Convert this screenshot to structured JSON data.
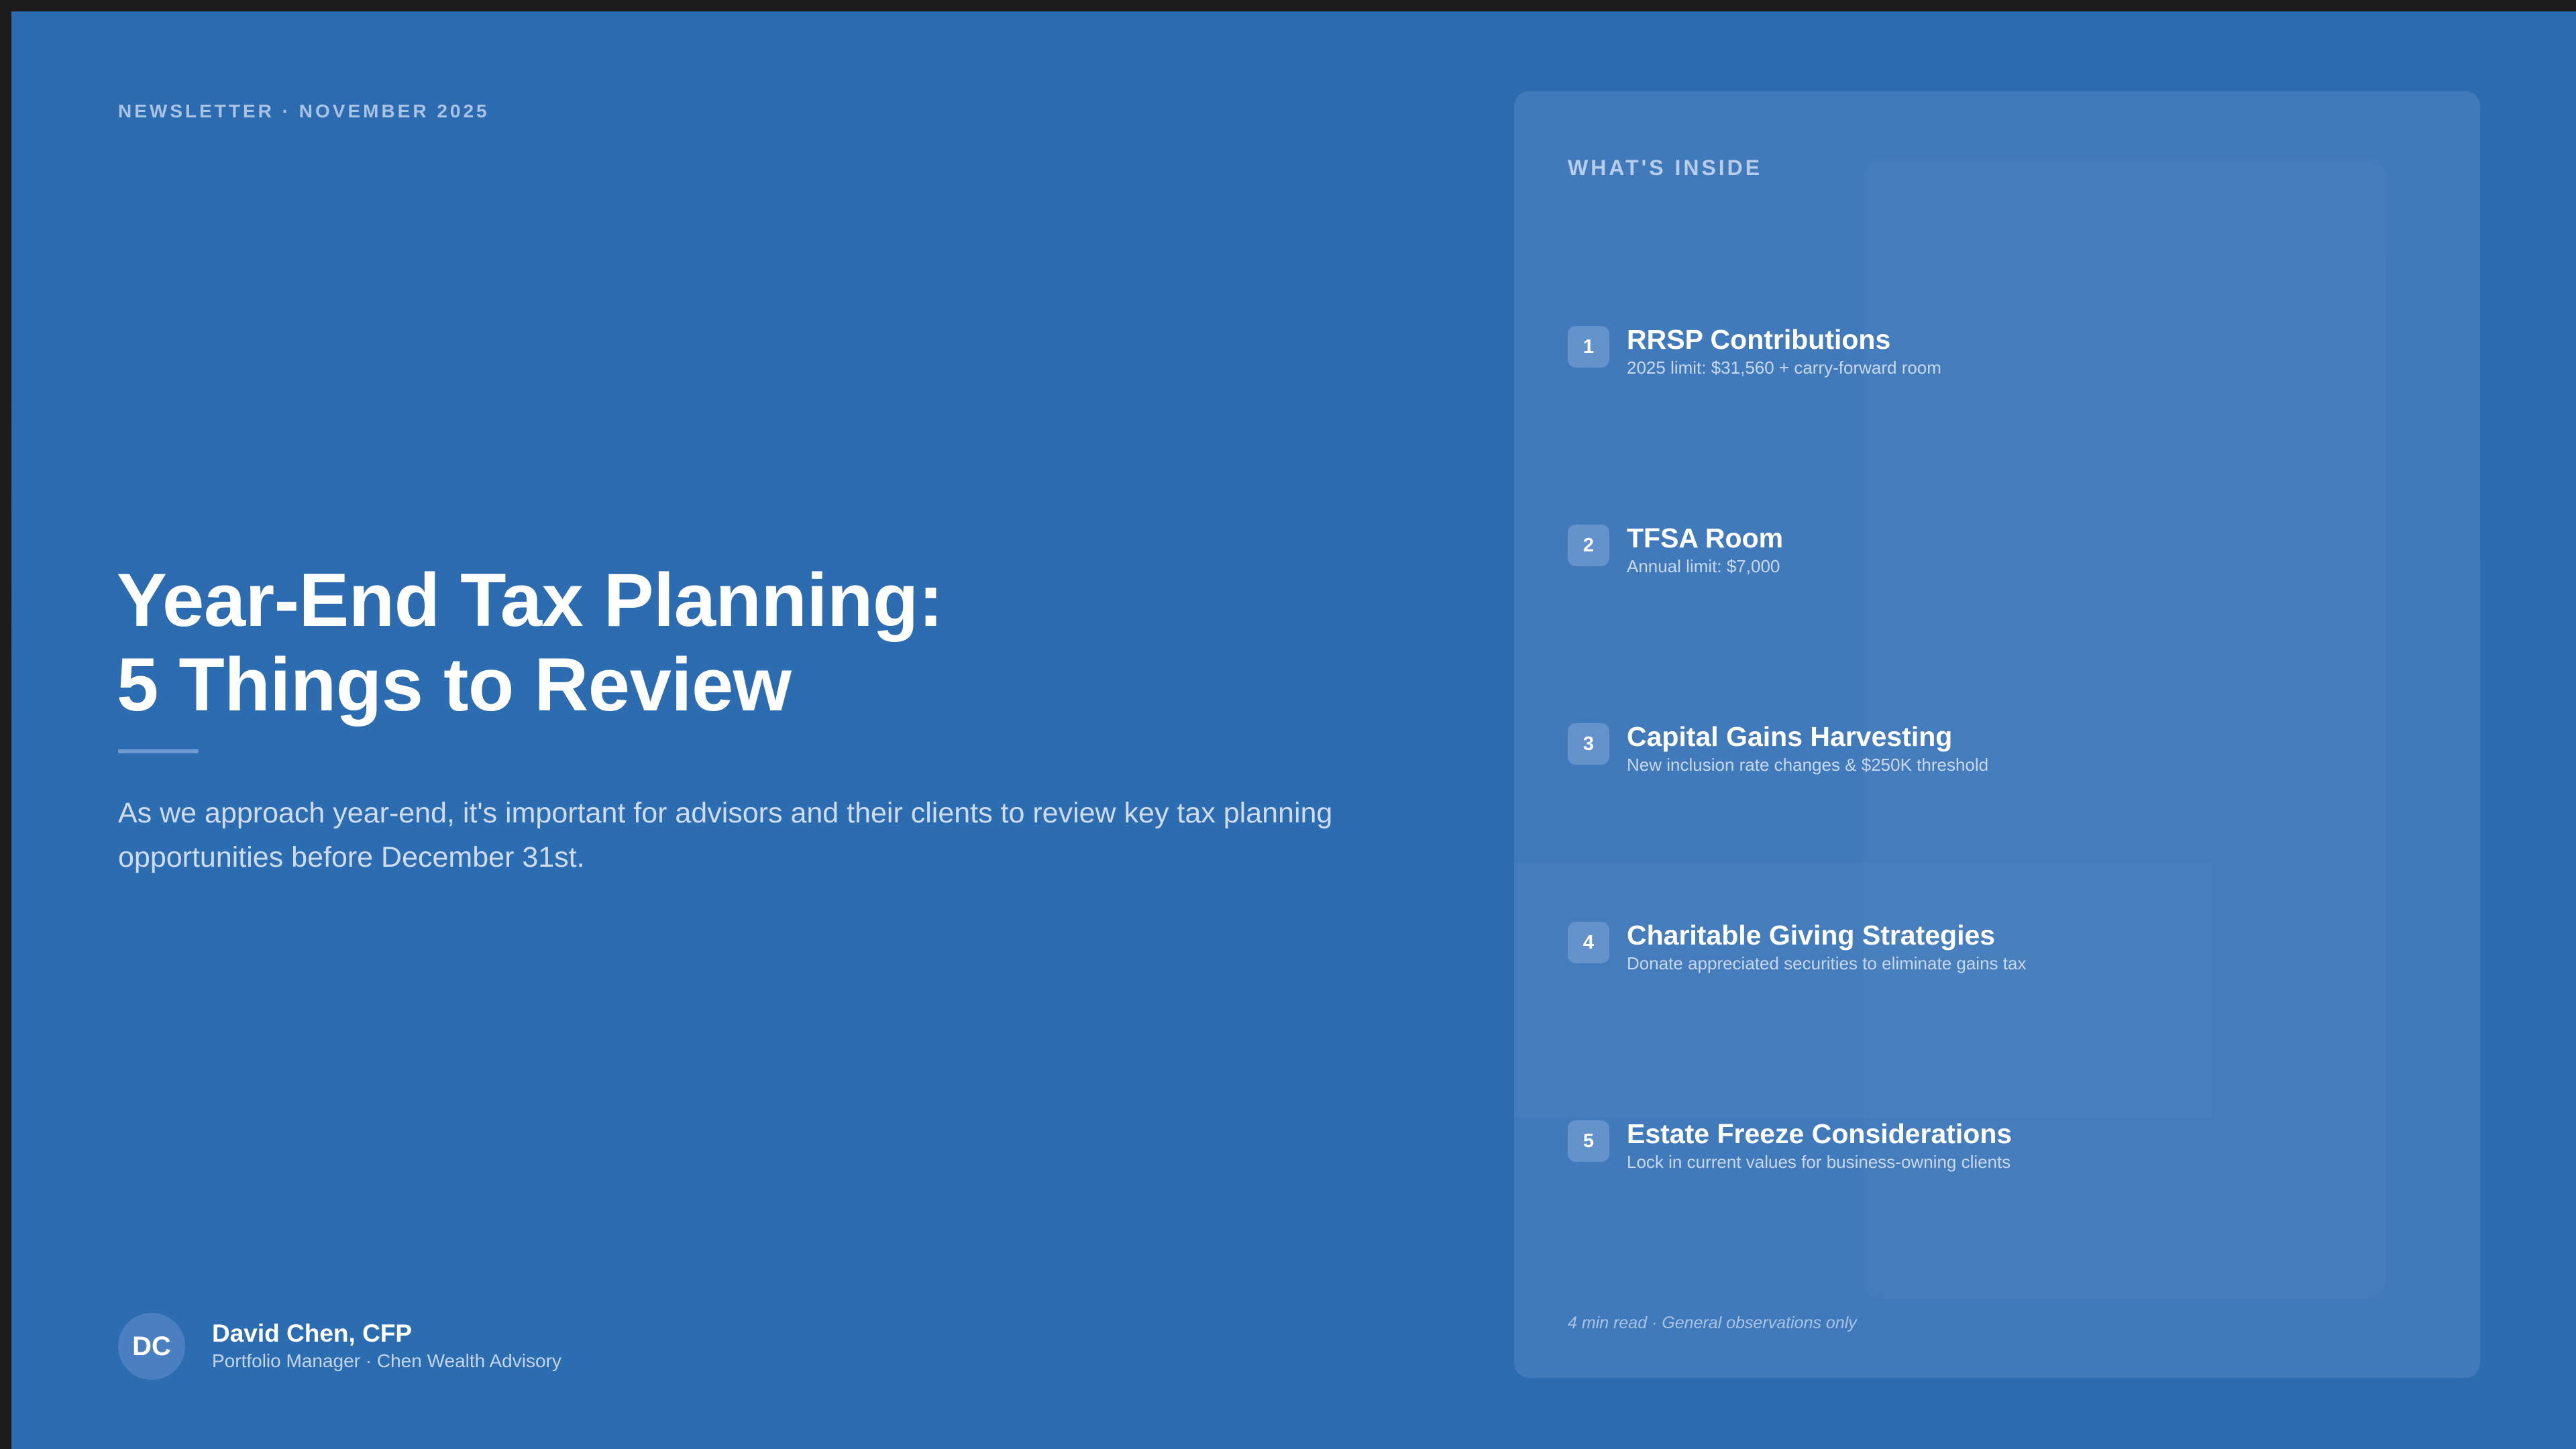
{
  "eyebrow": "NEWSLETTER · NOVEMBER 2025",
  "headline": {
    "line1": "Year-End Tax Planning:",
    "line2": "5 Things to Review"
  },
  "intro": "As we approach year-end, it's important for advisors and their clients to review key tax planning opportunities before December 31st.",
  "author": {
    "initials": "DC",
    "name": "David Chen, CFP",
    "role": "Portfolio Manager · Chen Wealth Advisory"
  },
  "toc": {
    "title": "WHAT'S INSIDE",
    "items": [
      {
        "number": "1",
        "title": "RRSP Contributions",
        "subtitle": "2025 limit: $31,560 + carry-forward room"
      },
      {
        "number": "2",
        "title": "TFSA Room",
        "subtitle": "Annual limit: $7,000"
      },
      {
        "number": "3",
        "title": "Capital Gains Harvesting",
        "subtitle": "New inclusion rate changes & $250K threshold"
      },
      {
        "number": "4",
        "title": "Charitable Giving Strategies",
        "subtitle": "Donate appreciated securities to eliminate gains tax"
      },
      {
        "number": "5",
        "title": "Estate Freeze Considerations",
        "subtitle": "Lock in current values for business-owning clients"
      }
    ],
    "footnote": "4 min read · General observations only"
  },
  "colors": {
    "background": "#2d6bb0",
    "panel": "#417abb",
    "badge": "#6492cb",
    "avatar": "#4a7fc1",
    "accent_rule": "#6f9bd2"
  }
}
